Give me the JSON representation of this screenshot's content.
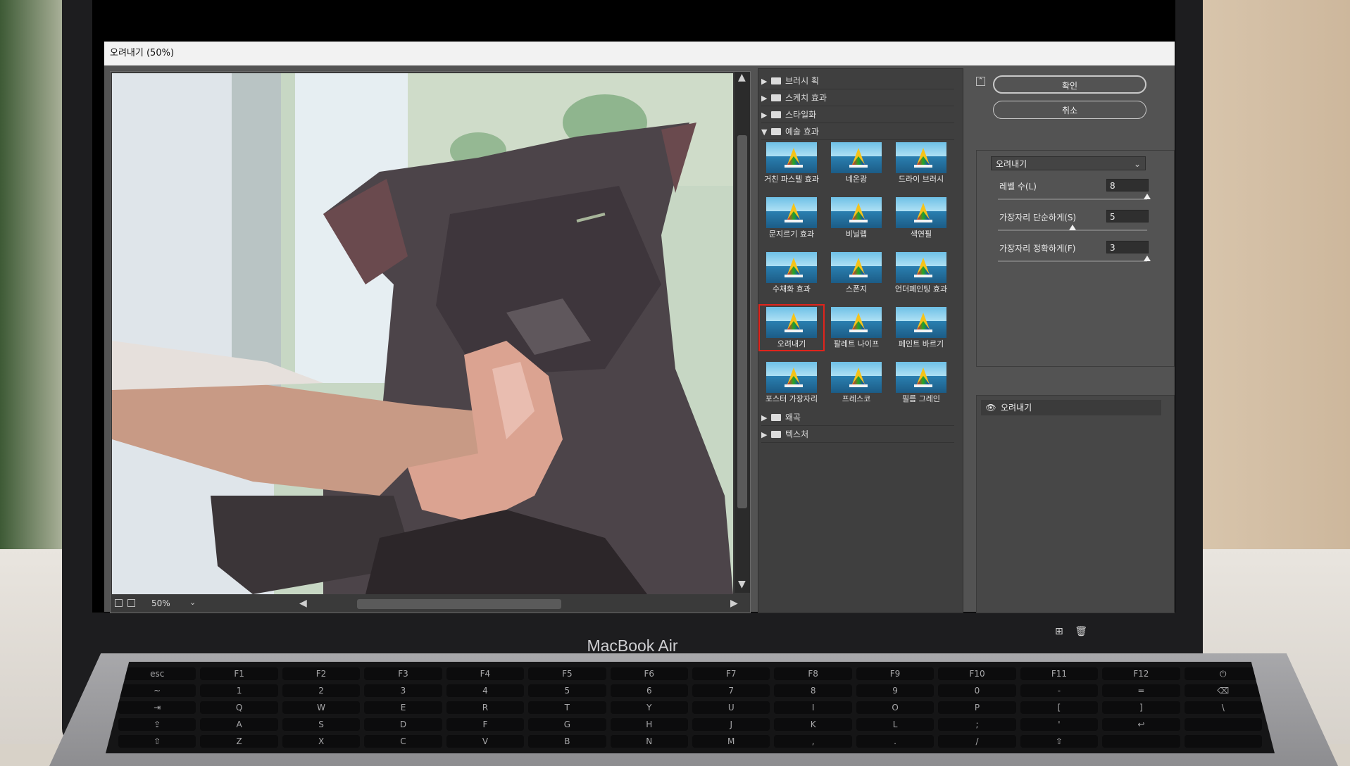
{
  "window": {
    "title": "오려내기 (50%)"
  },
  "device": {
    "brand": "MacBook Air"
  },
  "preview": {
    "zoom": "50%"
  },
  "gallery": {
    "folders_top": [
      "브러시 획",
      "스케치 효과",
      "스타일화"
    ],
    "open_folder": "예술 효과",
    "filters": [
      "거친 파스텔 효과",
      "네온광",
      "드라이 브러시",
      "문지르기 효과",
      "비닐랩",
      "색연필",
      "수채화 효과",
      "스폰지",
      "언더페인팅 효과",
      "오려내기",
      "팔레트 나이프",
      "페인트 바르기",
      "포스터 가장자리",
      "프레스코",
      "필름 그레인"
    ],
    "selected_filter": "오려내기",
    "folders_bottom": [
      "왜곡",
      "텍스처"
    ]
  },
  "settings": {
    "ok_label": "확인",
    "cancel_label": "취소",
    "filter_select": "오려내기",
    "params": [
      {
        "label": "레벨 수(L)",
        "value": "8",
        "level": 1.0
      },
      {
        "label": "가장자리 단순하게(S)",
        "value": "5",
        "level": 0.5
      },
      {
        "label": "가장자리 정확하게(F)",
        "value": "3",
        "level": 1.0
      }
    ],
    "layer_name": "오려내기"
  },
  "keyboard": {
    "rows": [
      [
        "esc",
        "F1",
        "F2",
        "F3",
        "F4",
        "F5",
        "F6",
        "F7",
        "F8",
        "F9",
        "F10",
        "F11",
        "F12",
        "⏻"
      ],
      [
        "~",
        "1",
        "2",
        "3",
        "4",
        "5",
        "6",
        "7",
        "8",
        "9",
        "0",
        "-",
        "=",
        "⌫"
      ],
      [
        "⇥",
        "Q",
        "W",
        "E",
        "R",
        "T",
        "Y",
        "U",
        "I",
        "O",
        "P",
        "[",
        "]",
        "\\"
      ],
      [
        "⇪",
        "A",
        "S",
        "D",
        "F",
        "G",
        "H",
        "J",
        "K",
        "L",
        ";",
        "'",
        "↩",
        ""
      ],
      [
        "⇧",
        "Z",
        "X",
        "C",
        "V",
        "B",
        "N",
        "M",
        ",",
        ".",
        "/",
        "⇧",
        "",
        ""
      ]
    ]
  },
  "colors": {
    "selection_outline": "#e0241c",
    "dialog_bg": "#535353"
  }
}
